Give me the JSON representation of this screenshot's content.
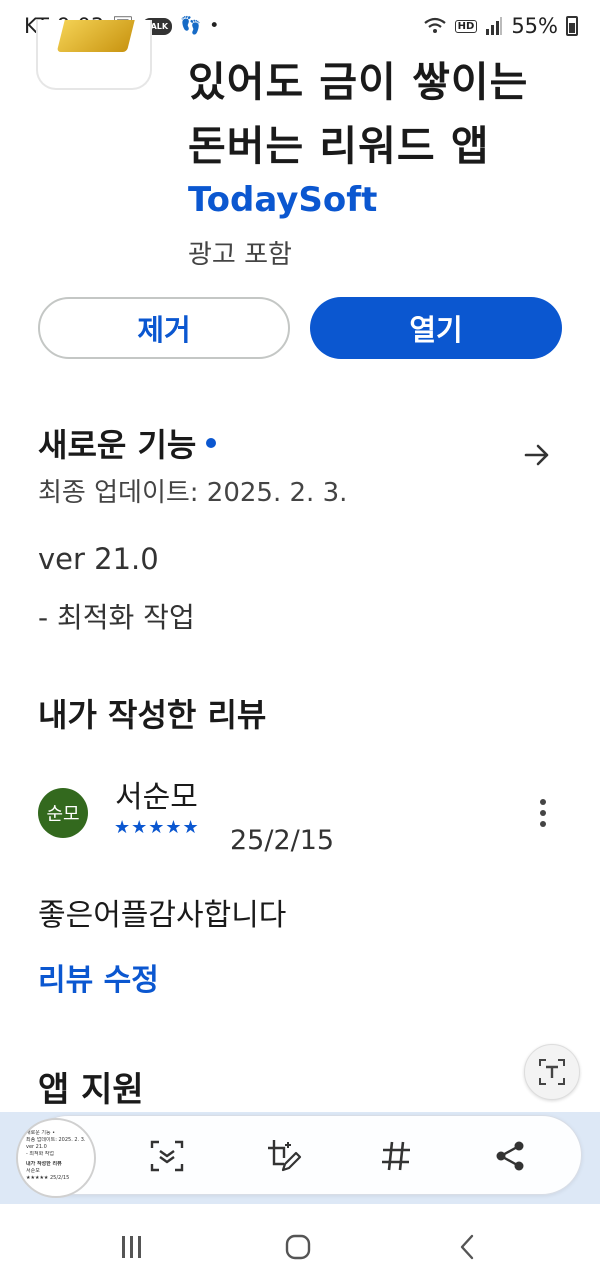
{
  "status_bar": {
    "carrier": "KT",
    "time": "9:03",
    "talk_badge": "TALK",
    "hd_label": "HD",
    "battery": "55%"
  },
  "app": {
    "title_line1": "있어도 금이 쌓이는",
    "title_line2": "돈버는 리워드 앱",
    "developer": "TodaySoft",
    "contains_ads": "광고 포함"
  },
  "actions": {
    "uninstall": "제거",
    "open": "열기"
  },
  "whats_new": {
    "title": "새로운 기능",
    "last_update": "최종 업데이트: 2025. 2. 3.",
    "version": "ver 21.0",
    "change": "- 최적화 작업"
  },
  "my_review": {
    "title": "내가 작성한 리뷰",
    "avatar_text": "순모",
    "reviewer": "서순모",
    "stars": "★★★★★",
    "rating": 5,
    "date": "25/2/15",
    "body": "좋은어플감사합니다",
    "edit_label": "리뷰 수정"
  },
  "support": {
    "title": "앱 지원"
  },
  "thumbnail": {
    "lines": [
      "새로운 기능 •",
      "최종 업데이트: 2025. 2. 3.",
      "ver 21.0",
      "- 최적화 작업",
      "내가 작성한 리뷰",
      "서순모",
      "★★★★★ 25/2/15"
    ]
  },
  "colors": {
    "accent": "#0b57d0",
    "avatar": "#33691e"
  }
}
